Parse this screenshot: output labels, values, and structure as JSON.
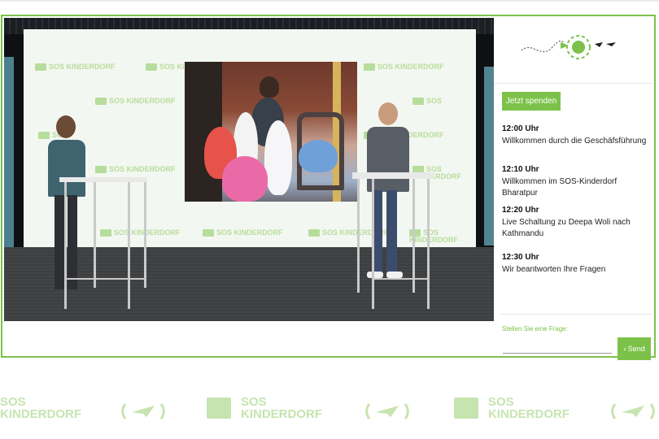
{
  "brand": {
    "name_line1": "SOS",
    "name_line2": "KINDERDORF",
    "accent_color": "#7cc24a",
    "watermark_color": "#c6e4b0"
  },
  "icons": {
    "donate_tracker": "globe-with-paperplane-path-icon",
    "send": "chevron-right-icon",
    "watermark_a": "sos-family-logo-icon",
    "watermark_b": "paperplane-broadcast-icon"
  },
  "sidebar": {
    "donate_label": "Jetzt spenden",
    "schedule": [
      {
        "time": "12:00 Uhr",
        "title": "Willkommen durch die Geschäfsführung"
      },
      {
        "time": "12:10 Uhr",
        "title": "Willkommen im SOS-Kinderdorf Bharatpur"
      },
      {
        "time": "12:20 Uhr",
        "title": "Live Schaltung zu Deepa Woli nach Kathmandu"
      },
      {
        "time": "12:30 Uhr",
        "title": "Wir beantworten Ihre Fragen"
      }
    ],
    "question": {
      "label": "Stellen Sie eine Frage:",
      "value": "",
      "placeholder": "",
      "send_label": "Send",
      "send_prefix": "›"
    }
  }
}
